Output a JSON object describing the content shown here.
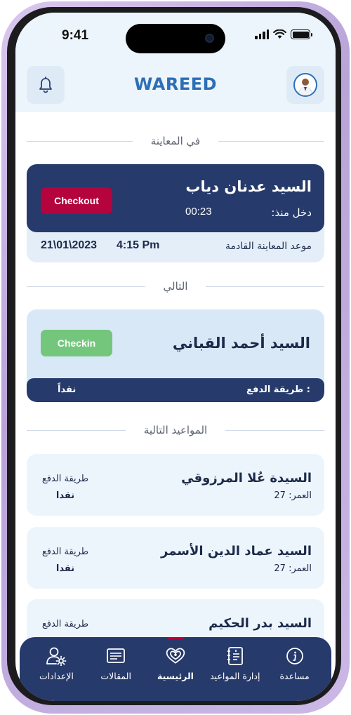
{
  "status_bar": {
    "time": "9:41"
  },
  "header": {
    "logo": "WAREED"
  },
  "current_section": {
    "title": "في المعاينة",
    "patient_name": "السيد عدنان دياب",
    "entered_label": "دخل منذ:",
    "entered_time": "00:23",
    "checkout_label": "Checkout",
    "next_appointment_label": "موعد المعاينة القادمة",
    "next_appointment_time": "4:15 Pm",
    "next_appointment_date": "21\\01\\2023"
  },
  "next_section": {
    "title": "التالي",
    "patient_name": "السيد أحمد القباني",
    "checkin_label": "Checkin",
    "payment_label": ": طريقة الدفع",
    "payment_value": "نقداً"
  },
  "upcoming_section": {
    "title": "المواعيد التالية",
    "appointments": [
      {
        "name": "السيدة عُلا المرزوقي",
        "age": "العمر: 27",
        "payment_label": "طريقة الدفع",
        "payment_value": "نقدا"
      },
      {
        "name": "السيد عماد الدين الأسمر",
        "age": "العمر: 27",
        "payment_label": "طريقة الدفع",
        "payment_value": "نقدا"
      },
      {
        "name": "السيد بدر الحكيم",
        "payment_label": "طريقة الدفع"
      }
    ]
  },
  "bottom_nav": {
    "items": [
      {
        "label": "مساعدة",
        "icon": "info-icon"
      },
      {
        "label": "إدارة المواعيد",
        "icon": "appointments-icon"
      },
      {
        "label": "الرئيسية",
        "icon": "home-heart-icon",
        "active": true
      },
      {
        "label": "المقالات",
        "icon": "articles-icon"
      },
      {
        "label": "الإعدادات",
        "icon": "user-settings-icon"
      }
    ]
  },
  "colors": {
    "navy": "#263a6b",
    "brand_blue": "#2c6fb7",
    "checkout_red": "#b5033d",
    "checkin_green": "#74c67c",
    "light_blue": "#edf5fc"
  }
}
